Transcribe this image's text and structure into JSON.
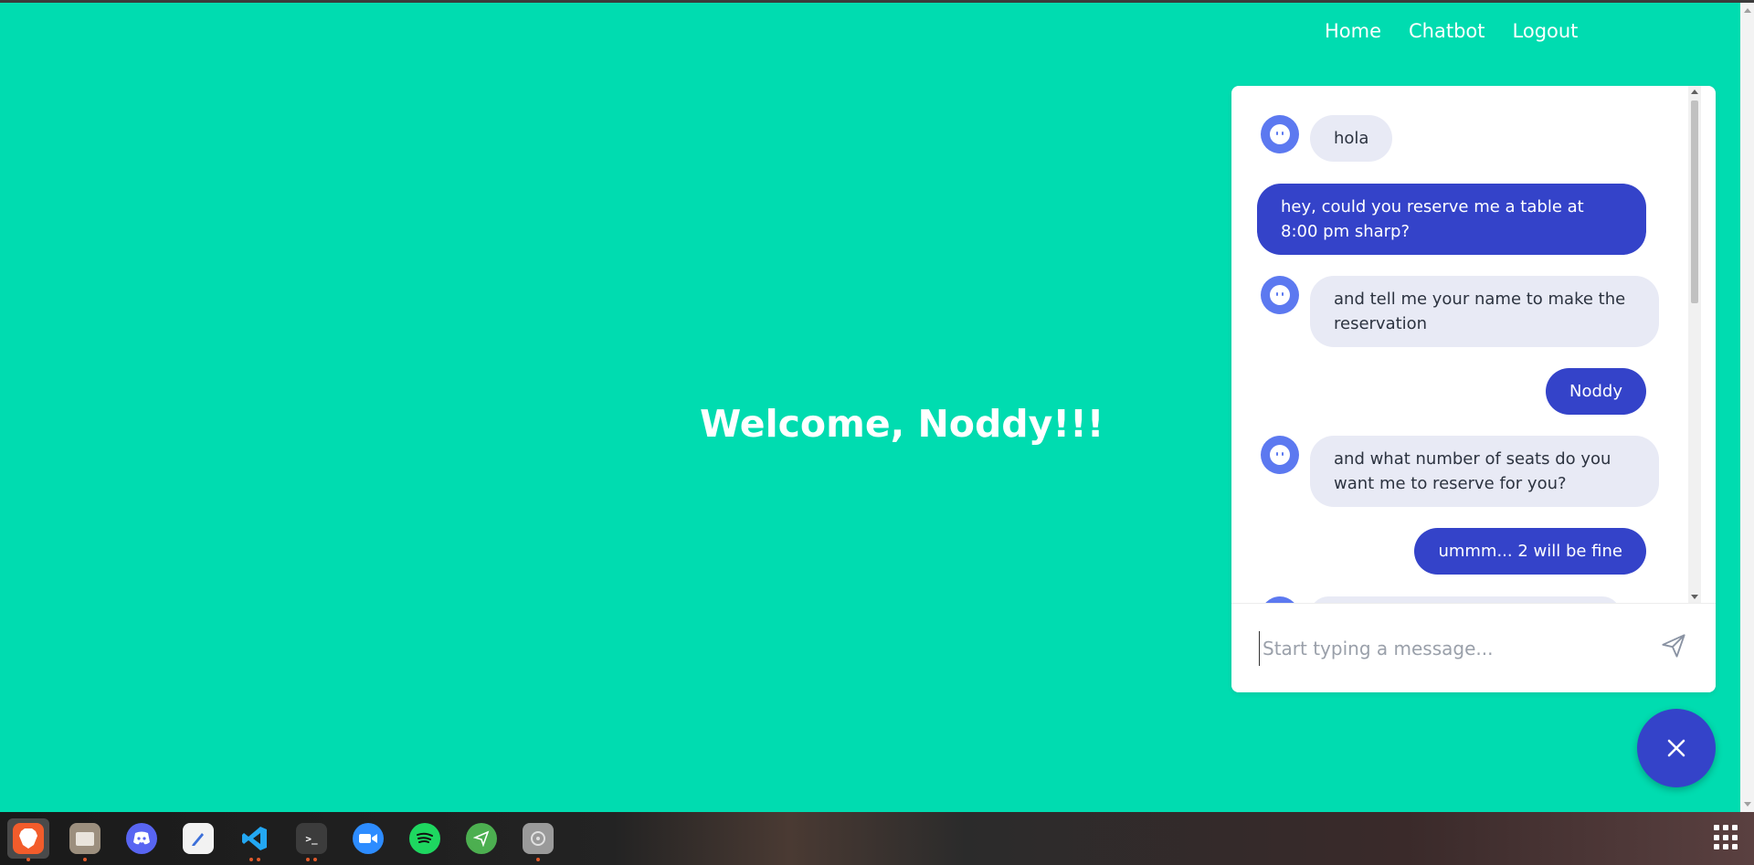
{
  "nav": {
    "home": "Home",
    "chatbot": "Chatbot",
    "logout": "Logout"
  },
  "welcome": "Welcome, Noddy!!!",
  "chat": {
    "messages": [
      {
        "from": "bot",
        "text": "hola"
      },
      {
        "from": "user",
        "text": "hey, could you reserve me a table at 8:00 pm sharp?"
      },
      {
        "from": "bot",
        "text": "and tell me your name to make the reservation"
      },
      {
        "from": "user",
        "text": "Noddy"
      },
      {
        "from": "bot",
        "text": "and what number of seats do you want me to reserve for you?"
      },
      {
        "from": "user",
        "text": "ummm... 2 will be fine"
      }
    ],
    "input_placeholder": "Start typing a message..."
  },
  "colors": {
    "background": "#00dcb0",
    "user_bubble": "#3443c9",
    "bot_bubble": "#e8eaf5",
    "avatar": "#5c79f0"
  },
  "taskbar": {
    "apps": [
      "brave-browser-icon",
      "files-icon",
      "discord-icon",
      "text-editor-icon",
      "vscode-icon",
      "terminal-icon",
      "zoom-icon",
      "spotify-icon",
      "telegram-icon",
      "disk-icon"
    ],
    "show_apps": "apps-grid-icon"
  }
}
